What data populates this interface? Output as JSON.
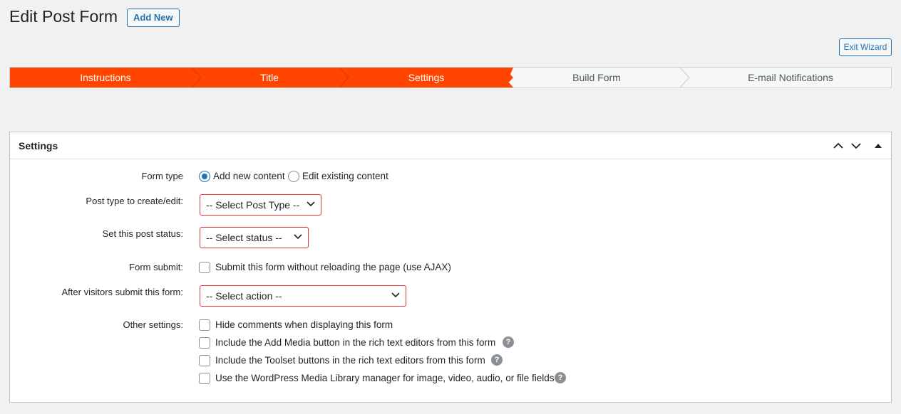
{
  "header": {
    "title": "Edit Post Form",
    "add_new_label": "Add New",
    "exit_wizard_label": "Exit Wizard"
  },
  "wizard": {
    "steps": [
      {
        "label": "Instructions",
        "state": "done"
      },
      {
        "label": "Title",
        "state": "done"
      },
      {
        "label": "Settings",
        "state": "current"
      },
      {
        "label": "Build Form",
        "state": "todo"
      },
      {
        "label": "E-mail Notifications",
        "state": "todo"
      }
    ],
    "active_color": "#ff4500"
  },
  "settings": {
    "title": "Settings",
    "form_type": {
      "label": "Form type",
      "options": [
        {
          "label": "Add new content",
          "checked": true
        },
        {
          "label": "Edit existing content",
          "checked": false
        }
      ]
    },
    "post_type": {
      "label": "Post type to create/edit:",
      "value": "-- Select Post Type --"
    },
    "post_status": {
      "label": "Set this post status:",
      "value": "-- Select status --"
    },
    "form_submit": {
      "label": "Form submit:",
      "option": "Submit this form without reloading the page (use AJAX)"
    },
    "after_submit": {
      "label": "After visitors submit this form:",
      "value": "-- Select action --"
    },
    "other": {
      "label": "Other settings:",
      "options": [
        {
          "label": "Hide comments when displaying this form",
          "help": false
        },
        {
          "label": "Include the Add Media button in the rich text editors from this form",
          "help": true
        },
        {
          "label": "Include the Toolset buttons in the rich text editors from this form",
          "help": true
        },
        {
          "label": "Use the WordPress Media Library manager for image, video, audio, or file fields",
          "help": true
        }
      ]
    }
  }
}
